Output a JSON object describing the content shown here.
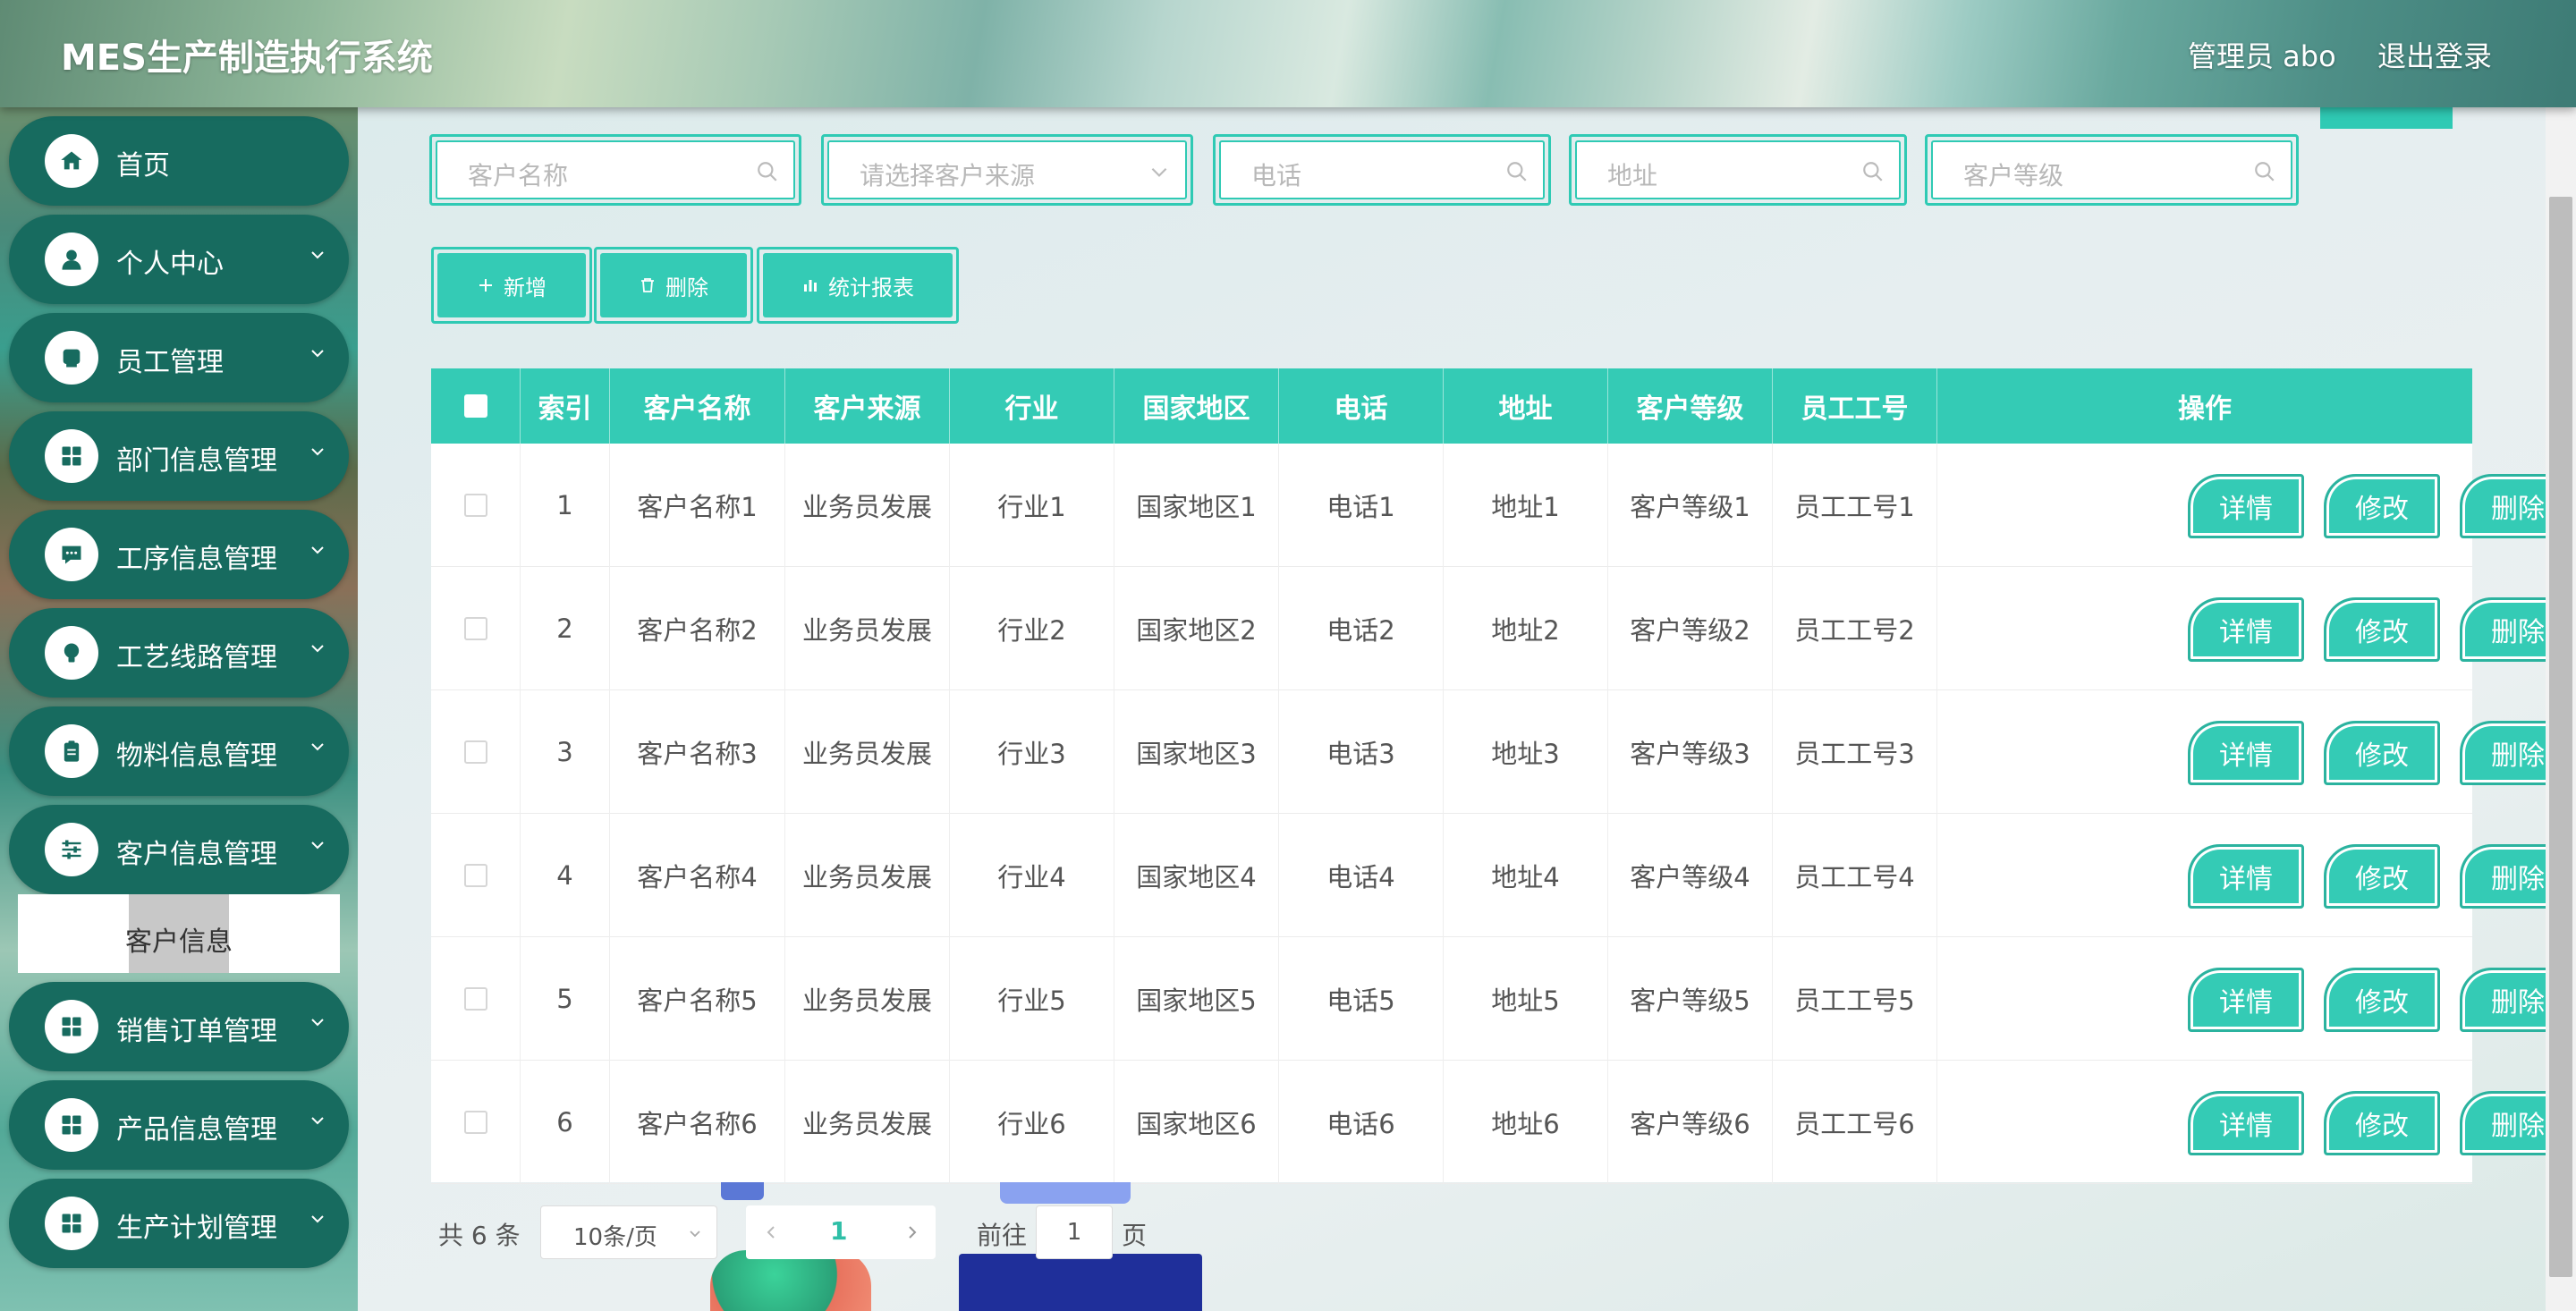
{
  "header": {
    "title": "MES生产制造执行系统",
    "user": "管理员 abo",
    "logout": "退出登录"
  },
  "sidebar": {
    "items": [
      {
        "label": "首页",
        "icon": "home-icon"
      },
      {
        "label": "个人中心",
        "icon": "user-icon"
      },
      {
        "label": "员工管理",
        "icon": "employee-icon"
      },
      {
        "label": "部门信息管理",
        "icon": "grid-icon"
      },
      {
        "label": "工序信息管理",
        "icon": "chat-icon"
      },
      {
        "label": "工艺线路管理",
        "icon": "bulb-icon"
      },
      {
        "label": "物料信息管理",
        "icon": "clipboard-icon"
      },
      {
        "label": "客户信息管理",
        "icon": "sliders-icon"
      },
      {
        "label": "销售订单管理",
        "icon": "grid-icon"
      },
      {
        "label": "产品信息管理",
        "icon": "grid-icon"
      },
      {
        "label": "生产计划管理",
        "icon": "grid-icon"
      }
    ],
    "submenu": {
      "label": "客户信息"
    }
  },
  "search": {
    "customer_name_placeholder": "客户名称",
    "customer_source_placeholder": "请选择客户来源",
    "phone_placeholder": "电话",
    "address_placeholder": "地址",
    "customer_level_placeholder": "客户等级"
  },
  "actions": {
    "add": "新增",
    "delete": "删除",
    "report": "统计报表"
  },
  "table": {
    "headers": [
      "索引",
      "客户名称",
      "客户来源",
      "行业",
      "国家地区",
      "电话",
      "地址",
      "客户等级",
      "员工工号",
      "操作"
    ],
    "rows": [
      [
        "1",
        "客户名称1",
        "业务员发展",
        "行业1",
        "国家地区1",
        "电话1",
        "地址1",
        "客户等级1",
        "员工工号1"
      ],
      [
        "2",
        "客户名称2",
        "业务员发展",
        "行业2",
        "国家地区2",
        "电话2",
        "地址2",
        "客户等级2",
        "员工工号2"
      ],
      [
        "3",
        "客户名称3",
        "业务员发展",
        "行业3",
        "国家地区3",
        "电话3",
        "地址3",
        "客户等级3",
        "员工工号3"
      ],
      [
        "4",
        "客户名称4",
        "业务员发展",
        "行业4",
        "国家地区4",
        "电话4",
        "地址4",
        "客户等级4",
        "员工工号4"
      ],
      [
        "5",
        "客户名称5",
        "业务员发展",
        "行业5",
        "国家地区5",
        "电话5",
        "地址5",
        "客户等级5",
        "员工工号5"
      ],
      [
        "6",
        "客户名称6",
        "业务员发展",
        "行业6",
        "国家地区6",
        "电话6",
        "地址6",
        "客户等级6",
        "员工工号6"
      ]
    ],
    "ops": {
      "detail": "详情",
      "edit": "修改",
      "remove": "删除"
    }
  },
  "pagination": {
    "total": "共 6 条",
    "page_size": "10条/页",
    "current_page": "1",
    "goto_prefix": "前往",
    "goto_value": "1",
    "goto_suffix": "页"
  },
  "colors": {
    "accent": "#34cbb5",
    "sidebar_item": "#176b5f"
  }
}
